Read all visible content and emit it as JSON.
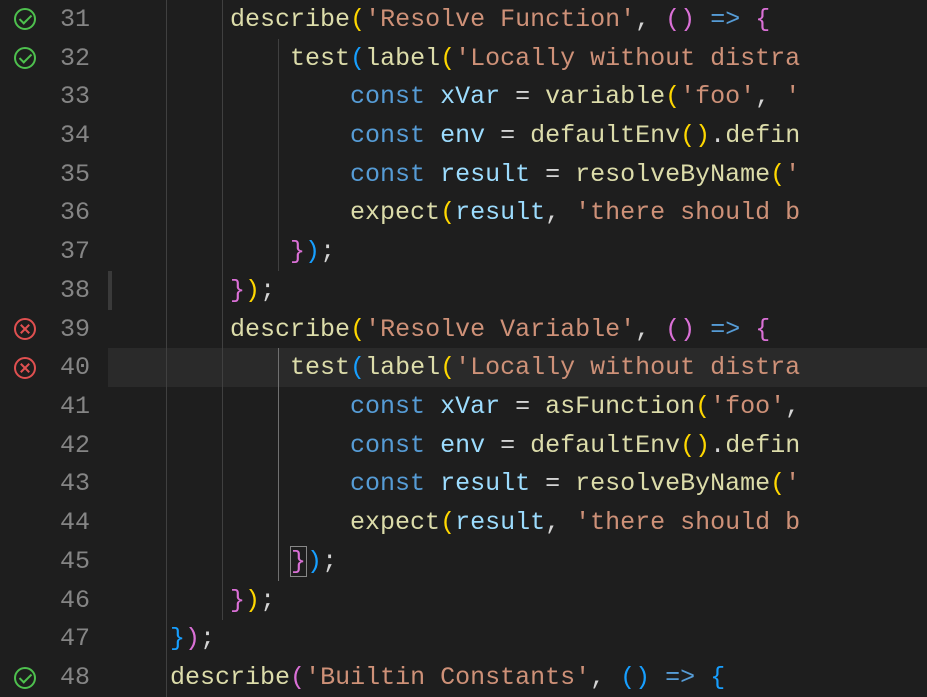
{
  "lines": [
    {
      "num": 31,
      "status": "pass",
      "indent": 8,
      "tokens": [
        {
          "t": "describe",
          "c": "func"
        },
        {
          "t": "(",
          "c": "paren-yellow"
        },
        {
          "t": "'Resolve Function'",
          "c": "string"
        },
        {
          "t": ", ",
          "c": "default"
        },
        {
          "t": "(",
          "c": "paren-purple"
        },
        {
          "t": ")",
          "c": "paren-purple"
        },
        {
          "t": " ",
          "c": "default"
        },
        {
          "t": "=>",
          "c": "keyword"
        },
        {
          "t": " ",
          "c": "default"
        },
        {
          "t": "{",
          "c": "paren-purple"
        }
      ]
    },
    {
      "num": 32,
      "status": "pass",
      "indent": 12,
      "tokens": [
        {
          "t": "test",
          "c": "func"
        },
        {
          "t": "(",
          "c": "paren-blue"
        },
        {
          "t": "label",
          "c": "func"
        },
        {
          "t": "(",
          "c": "paren-yellow"
        },
        {
          "t": "'Locally without distra",
          "c": "string"
        }
      ]
    },
    {
      "num": 33,
      "status": null,
      "indent": 16,
      "tokens": [
        {
          "t": "const",
          "c": "keyword"
        },
        {
          "t": " ",
          "c": "default"
        },
        {
          "t": "xVar",
          "c": "var"
        },
        {
          "t": " = ",
          "c": "default"
        },
        {
          "t": "variable",
          "c": "func"
        },
        {
          "t": "(",
          "c": "paren-yellow"
        },
        {
          "t": "'foo'",
          "c": "string"
        },
        {
          "t": ", ",
          "c": "default"
        },
        {
          "t": "'",
          "c": "string"
        }
      ]
    },
    {
      "num": 34,
      "status": null,
      "indent": 16,
      "tokens": [
        {
          "t": "const",
          "c": "keyword"
        },
        {
          "t": " ",
          "c": "default"
        },
        {
          "t": "env",
          "c": "var"
        },
        {
          "t": " = ",
          "c": "default"
        },
        {
          "t": "defaultEnv",
          "c": "func"
        },
        {
          "t": "(",
          "c": "paren-yellow"
        },
        {
          "t": ")",
          "c": "paren-yellow"
        },
        {
          "t": ".",
          "c": "default"
        },
        {
          "t": "defin",
          "c": "func"
        }
      ]
    },
    {
      "num": 35,
      "status": null,
      "indent": 16,
      "tokens": [
        {
          "t": "const",
          "c": "keyword"
        },
        {
          "t": " ",
          "c": "default"
        },
        {
          "t": "result",
          "c": "var"
        },
        {
          "t": " = ",
          "c": "default"
        },
        {
          "t": "resolveByName",
          "c": "func"
        },
        {
          "t": "(",
          "c": "paren-yellow"
        },
        {
          "t": "'",
          "c": "string"
        }
      ]
    },
    {
      "num": 36,
      "status": null,
      "indent": 16,
      "tokens": [
        {
          "t": "expect",
          "c": "func"
        },
        {
          "t": "(",
          "c": "paren-yellow"
        },
        {
          "t": "result",
          "c": "var"
        },
        {
          "t": ", ",
          "c": "default"
        },
        {
          "t": "'there should b",
          "c": "string"
        }
      ]
    },
    {
      "num": 37,
      "status": null,
      "indent": 12,
      "tokens": [
        {
          "t": "}",
          "c": "paren-purple"
        },
        {
          "t": ")",
          "c": "paren-blue"
        },
        {
          "t": ";",
          "c": "default"
        }
      ]
    },
    {
      "num": 38,
      "status": null,
      "indent": 8,
      "marker": true,
      "tokens": [
        {
          "t": "}",
          "c": "paren-purple"
        },
        {
          "t": ")",
          "c": "paren-yellow"
        },
        {
          "t": ";",
          "c": "default"
        }
      ]
    },
    {
      "num": 39,
      "status": "fail",
      "indent": 8,
      "tokens": [
        {
          "t": "describe",
          "c": "func"
        },
        {
          "t": "(",
          "c": "paren-yellow"
        },
        {
          "t": "'Resolve Variable'",
          "c": "string"
        },
        {
          "t": ", ",
          "c": "default"
        },
        {
          "t": "(",
          "c": "paren-purple"
        },
        {
          "t": ")",
          "c": "paren-purple"
        },
        {
          "t": " ",
          "c": "default"
        },
        {
          "t": "=>",
          "c": "keyword"
        },
        {
          "t": " ",
          "c": "default"
        },
        {
          "t": "{",
          "c": "paren-purple"
        }
      ]
    },
    {
      "num": 40,
      "status": "fail",
      "indent": 12,
      "highlighted": true,
      "tokens": [
        {
          "t": "test",
          "c": "func"
        },
        {
          "t": "(",
          "c": "paren-blue"
        },
        {
          "t": "label",
          "c": "func"
        },
        {
          "t": "(",
          "c": "paren-yellow"
        },
        {
          "t": "'Locally without distra",
          "c": "string"
        }
      ]
    },
    {
      "num": 41,
      "status": null,
      "indent": 16,
      "tokens": [
        {
          "t": "const",
          "c": "keyword"
        },
        {
          "t": " ",
          "c": "default"
        },
        {
          "t": "xVar",
          "c": "var"
        },
        {
          "t": " = ",
          "c": "default"
        },
        {
          "t": "asFunction",
          "c": "func"
        },
        {
          "t": "(",
          "c": "paren-yellow"
        },
        {
          "t": "'foo'",
          "c": "string"
        },
        {
          "t": ",",
          "c": "default"
        }
      ]
    },
    {
      "num": 42,
      "status": null,
      "indent": 16,
      "tokens": [
        {
          "t": "const",
          "c": "keyword"
        },
        {
          "t": " ",
          "c": "default"
        },
        {
          "t": "env",
          "c": "var"
        },
        {
          "t": " = ",
          "c": "default"
        },
        {
          "t": "defaultEnv",
          "c": "func"
        },
        {
          "t": "(",
          "c": "paren-yellow"
        },
        {
          "t": ")",
          "c": "paren-yellow"
        },
        {
          "t": ".",
          "c": "default"
        },
        {
          "t": "defin",
          "c": "func"
        }
      ]
    },
    {
      "num": 43,
      "status": null,
      "indent": 16,
      "tokens": [
        {
          "t": "const",
          "c": "keyword"
        },
        {
          "t": " ",
          "c": "default"
        },
        {
          "t": "result",
          "c": "var"
        },
        {
          "t": " = ",
          "c": "default"
        },
        {
          "t": "resolveByName",
          "c": "func"
        },
        {
          "t": "(",
          "c": "paren-yellow"
        },
        {
          "t": "'",
          "c": "string"
        }
      ]
    },
    {
      "num": 44,
      "status": null,
      "indent": 16,
      "tokens": [
        {
          "t": "expect",
          "c": "func"
        },
        {
          "t": "(",
          "c": "paren-yellow"
        },
        {
          "t": "result",
          "c": "var"
        },
        {
          "t": ", ",
          "c": "default"
        },
        {
          "t": "'there should b",
          "c": "string"
        }
      ]
    },
    {
      "num": 45,
      "status": null,
      "indent": 12,
      "tokens": [
        {
          "t": "}",
          "c": "paren-purple",
          "match": true
        },
        {
          "t": ")",
          "c": "paren-blue"
        },
        {
          "t": ";",
          "c": "default"
        }
      ]
    },
    {
      "num": 46,
      "status": null,
      "indent": 8,
      "tokens": [
        {
          "t": "}",
          "c": "paren-purple"
        },
        {
          "t": ")",
          "c": "paren-yellow"
        },
        {
          "t": ";",
          "c": "default"
        }
      ]
    },
    {
      "num": 47,
      "status": null,
      "indent": 4,
      "tokens": [
        {
          "t": "}",
          "c": "paren-blue"
        },
        {
          "t": ")",
          "c": "paren-purple"
        },
        {
          "t": ";",
          "c": "default"
        }
      ]
    },
    {
      "num": 48,
      "status": "pass",
      "indent": 4,
      "tokens": [
        {
          "t": "describe",
          "c": "func"
        },
        {
          "t": "(",
          "c": "paren-purple"
        },
        {
          "t": "'Builtin Constants'",
          "c": "string"
        },
        {
          "t": ", ",
          "c": "default"
        },
        {
          "t": "(",
          "c": "paren-blue"
        },
        {
          "t": ")",
          "c": "paren-blue"
        },
        {
          "t": " ",
          "c": "default"
        },
        {
          "t": "=>",
          "c": "keyword"
        },
        {
          "t": " ",
          "c": "default"
        },
        {
          "t": "{",
          "c": "paren-blue"
        }
      ]
    }
  ],
  "charWidth": 14,
  "baseIndentPx": 0,
  "spacePerIndent": 14
}
